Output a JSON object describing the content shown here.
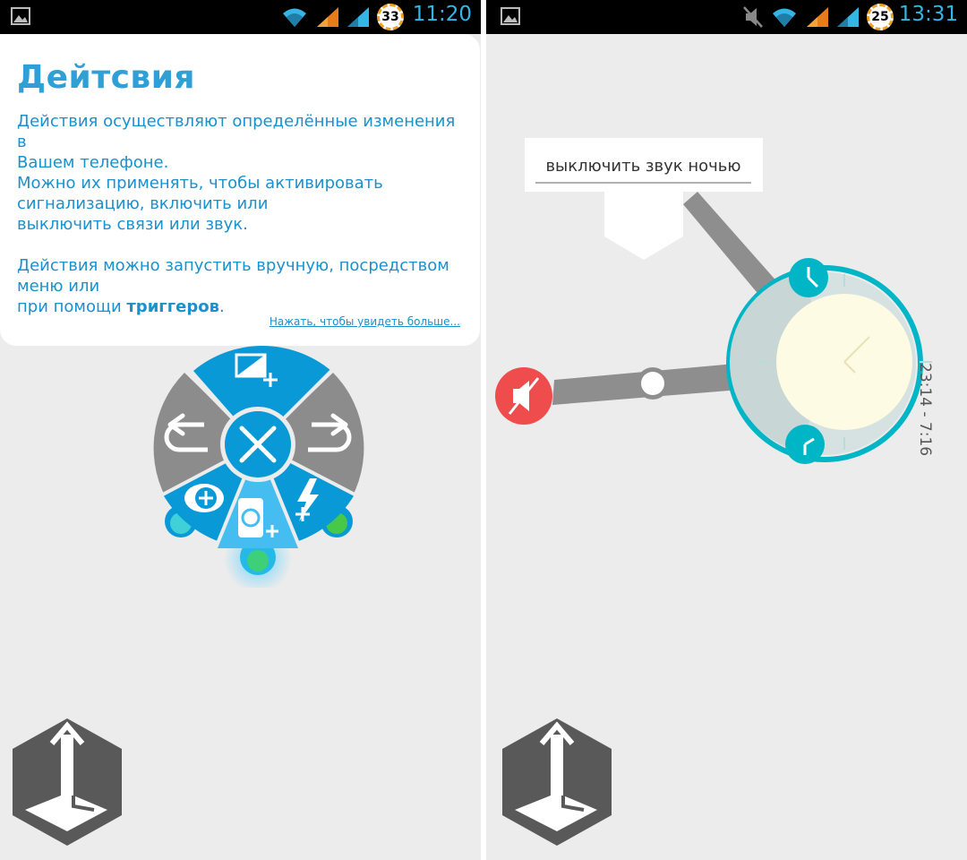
{
  "left_screen": {
    "status_bar": {
      "time": "11:20",
      "battery_level": "33",
      "icons": [
        "gallery-icon",
        "wifi-icon",
        "signal-icon",
        "signal-icon"
      ]
    },
    "card": {
      "title": "Дейтсвия",
      "paragraph1_line1": "Действия осуществляют определённые изменения в",
      "paragraph1_line2": "Вашем телефоне.",
      "paragraph1_line3": "Можно их применять, чтобы активировать",
      "paragraph1_line4": "сигнализацию, включить или",
      "paragraph1_line5": "выключить связи или звук.",
      "paragraph2_line1": "Действия можно запустить вручную, посредством",
      "paragraph2_line2": "меню или",
      "paragraph2_prefix": "при помощи ",
      "paragraph2_bold": "триггеров",
      "paragraph2_suffix": ".",
      "link": "Нажать, чтобы увидеть больше..."
    },
    "radial_menu": {
      "segments": [
        "add-display-action",
        "undo",
        "redo",
        "add-toggle-action",
        "add-flash-action",
        "add-phone-action"
      ],
      "center": "close"
    }
  },
  "right_screen": {
    "status_bar": {
      "time": "13:31",
      "battery_level": "25",
      "icons": [
        "gallery-icon",
        "mute-icon",
        "wifi-icon",
        "signal-icon",
        "signal-icon"
      ]
    },
    "tooltip_input_value": "выключить звук ночью",
    "time_range": "23:14 - 7:16",
    "colors": {
      "accent": "#00b5c6",
      "mute_action": "#ef4d4d",
      "clock_face": "#fdfbe4"
    }
  },
  "colors": {
    "blue_segment": "#0899d6",
    "gray_segment": "#8c8c8c",
    "link_blue": "#1a91cc",
    "status_time": "#35b5e5"
  }
}
